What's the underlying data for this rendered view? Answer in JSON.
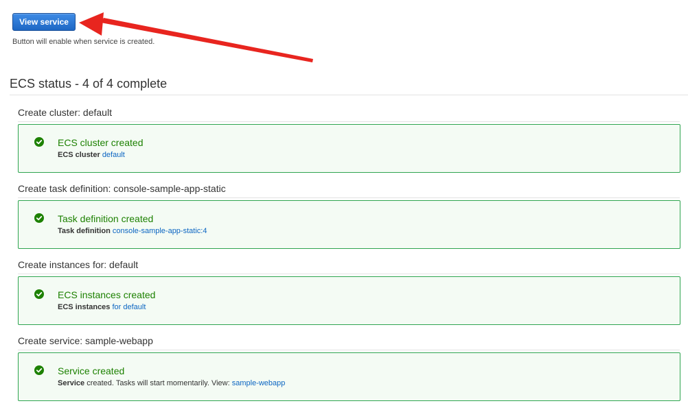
{
  "top": {
    "view_service_label": "View service",
    "note": "Button will enable when service is created."
  },
  "ecs_status": {
    "title": "ECS status - 4 of 4 complete"
  },
  "steps": [
    {
      "group_title": "Create cluster: default",
      "status_title": "ECS cluster created",
      "detail_label": "ECS cluster",
      "detail_text": " ",
      "link_text": "default"
    },
    {
      "group_title": "Create task definition: console-sample-app-static",
      "status_title": "Task definition created",
      "detail_label": "Task definition",
      "detail_text": " ",
      "link_text": "console-sample-app-static:4"
    },
    {
      "group_title": "Create instances for: default",
      "status_title": "ECS instances created",
      "detail_label": "ECS instances",
      "detail_text": " ",
      "link_text": "for default"
    },
    {
      "group_title": "Create service: sample-webapp",
      "status_title": "Service created",
      "detail_label": "Service",
      "detail_text": " created. Tasks will start momentarily. View: ",
      "link_text": "sample-webapp"
    }
  ],
  "colors": {
    "success": "#1d8102",
    "link": "#0b65c2",
    "button": "#1e67c4",
    "annotation_arrow": "#e8251f"
  },
  "icons": {
    "status": "check-circle-icon",
    "annotation": "arrow-annotation"
  }
}
